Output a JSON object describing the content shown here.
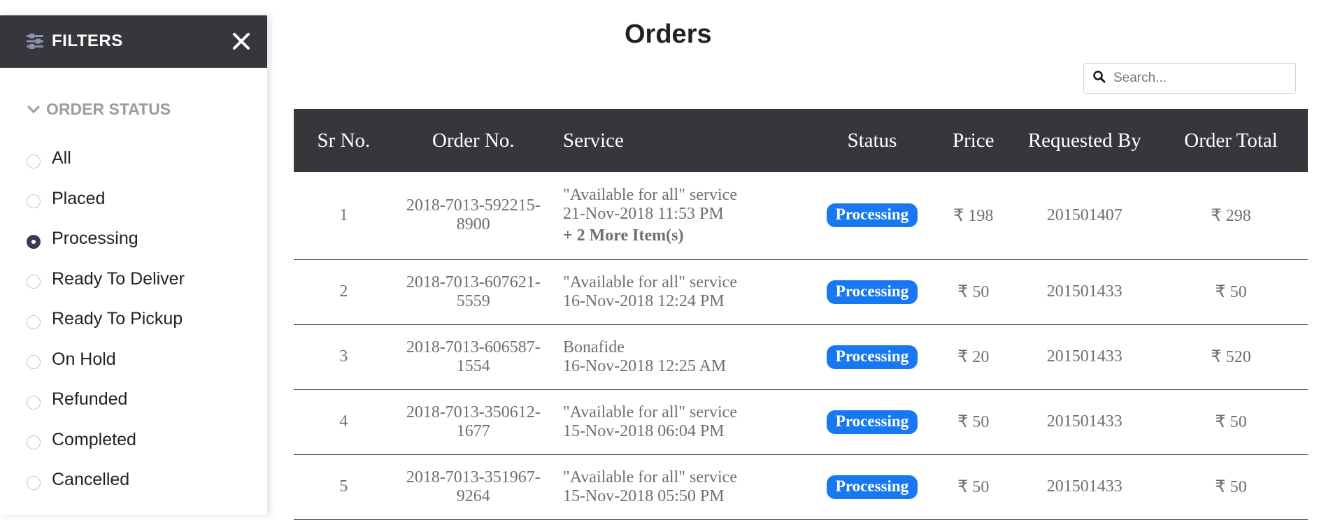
{
  "sidebar": {
    "title": "FILTERS",
    "section_title": "ORDER STATUS",
    "options": [
      {
        "label": "All",
        "selected": false
      },
      {
        "label": "Placed",
        "selected": false
      },
      {
        "label": "Processing",
        "selected": true
      },
      {
        "label": "Ready To Deliver",
        "selected": false
      },
      {
        "label": "Ready To Pickup",
        "selected": false
      },
      {
        "label": "On Hold",
        "selected": false
      },
      {
        "label": "Refunded",
        "selected": false
      },
      {
        "label": "Completed",
        "selected": false
      },
      {
        "label": "Cancelled",
        "selected": false
      }
    ]
  },
  "main": {
    "title": "Orders",
    "search": {
      "placeholder": "Search...",
      "value": ""
    }
  },
  "table": {
    "headers": [
      "Sr No.",
      "Order No.",
      "Service",
      "Status",
      "Price",
      "Requested By",
      "Order Total"
    ],
    "rows": [
      {
        "sr": "1",
        "order_no": "2018-7013-592215-8900",
        "service": "\"Available for all\" service",
        "date": "21-Nov-2018 11:53 PM",
        "more": "+ 2 More Item(s)",
        "status": "Processing",
        "price": "₹ 198",
        "requested_by": "201501407",
        "total": "₹ 298"
      },
      {
        "sr": "2",
        "order_no": "2018-7013-607621-5559",
        "service": "\"Available for all\" service",
        "date": "16-Nov-2018 12:24 PM",
        "more": "",
        "status": "Processing",
        "price": "₹ 50",
        "requested_by": "201501433",
        "total": "₹ 50"
      },
      {
        "sr": "3",
        "order_no": "2018-7013-606587-1554",
        "service": "Bonafide",
        "date": "16-Nov-2018 12:25 AM",
        "more": "",
        "status": "Processing",
        "price": "₹ 20",
        "requested_by": "201501433",
        "total": "₹ 520"
      },
      {
        "sr": "4",
        "order_no": "2018-7013-350612-1677",
        "service": "\"Available for all\" service",
        "date": "15-Nov-2018 06:04 PM",
        "more": "",
        "status": "Processing",
        "price": "₹ 50",
        "requested_by": "201501433",
        "total": "₹ 50"
      },
      {
        "sr": "5",
        "order_no": "2018-7013-351967-9264",
        "service": "\"Available for all\" service",
        "date": "15-Nov-2018 05:50 PM",
        "more": "",
        "status": "Processing",
        "price": "₹ 50",
        "requested_by": "201501433",
        "total": "₹ 50"
      }
    ]
  },
  "colors": {
    "header_bg": "#36373b",
    "badge_bg": "#1778f2",
    "selected_radio": "#3a3950"
  },
  "icons": {
    "filter": "sliders-icon",
    "close": "close-icon",
    "section_toggle": "chevron-down-icon",
    "search": "search-icon"
  }
}
